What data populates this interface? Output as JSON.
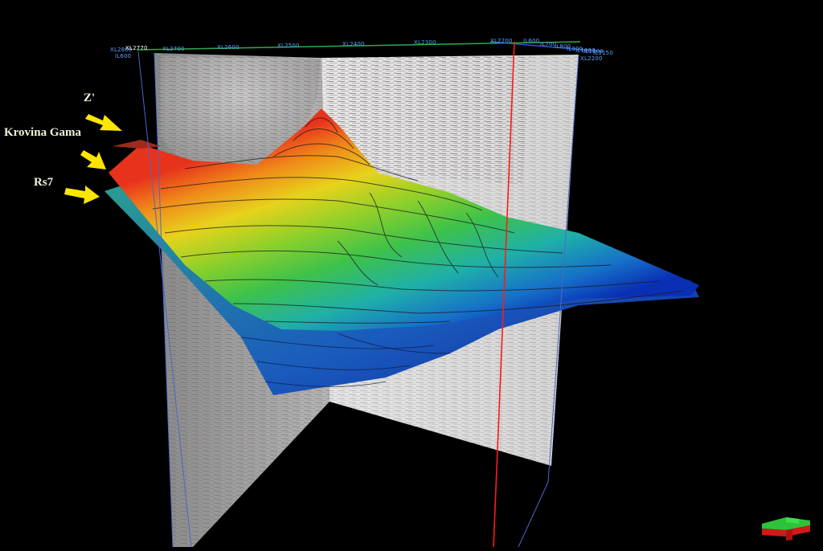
{
  "viewer": {
    "background_color": "#000000",
    "icons": {
      "horizon_arrow": "yellow-arrow-icon",
      "orientation": "orientation-cube-icon"
    }
  },
  "annotations": {
    "horizon_z": "Z'",
    "horizon_krovina": "Krovina Gama",
    "horizon_rs7": "Rs7",
    "arrow_color": "#ffe600"
  },
  "axis_labels": {
    "top": [
      "XL2800",
      "XL2770",
      "XL2700",
      "XL2600",
      "XL2500",
      "XL2400",
      "XL2300",
      "XL2200",
      "IL600",
      "IL700",
      "IL800",
      "IL900",
      "IL1000",
      "IL1100",
      "IL1150"
    ],
    "left_inline": "IL600",
    "right_crossline": "XL2200"
  },
  "colors": {
    "surface_high": "#e8331c",
    "surface_mid_high": "#e8d21c",
    "surface_mid": "#5ad02a",
    "surface_mid_low": "#1fb0a8",
    "surface_low": "#0a2fb5",
    "seismic_panel": "#d9d9d9",
    "well_line": "#ff1a1a",
    "axis_blue": "#5ea0ff"
  }
}
